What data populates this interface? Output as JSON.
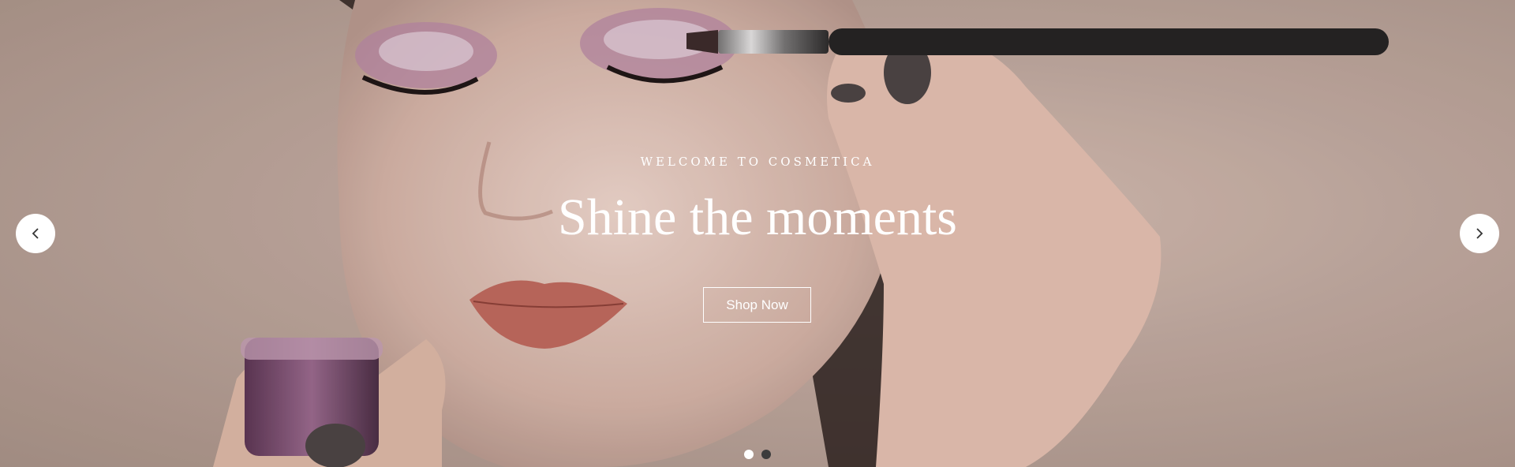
{
  "hero": {
    "eyebrow": "WELCOME TO COSMETICA",
    "headline": "Shine the moments",
    "cta_label": "Shop Now"
  },
  "controls": {
    "prev_icon": "chevron-left-icon",
    "next_icon": "chevron-right-icon",
    "dots": [
      {
        "state": "active"
      },
      {
        "state": "inactive"
      }
    ]
  },
  "colors": {
    "text": "#ffffff",
    "arrow_bg": "#ffffff",
    "dot_active": "#ffffff",
    "dot_inactive": "#3c3c3c"
  }
}
